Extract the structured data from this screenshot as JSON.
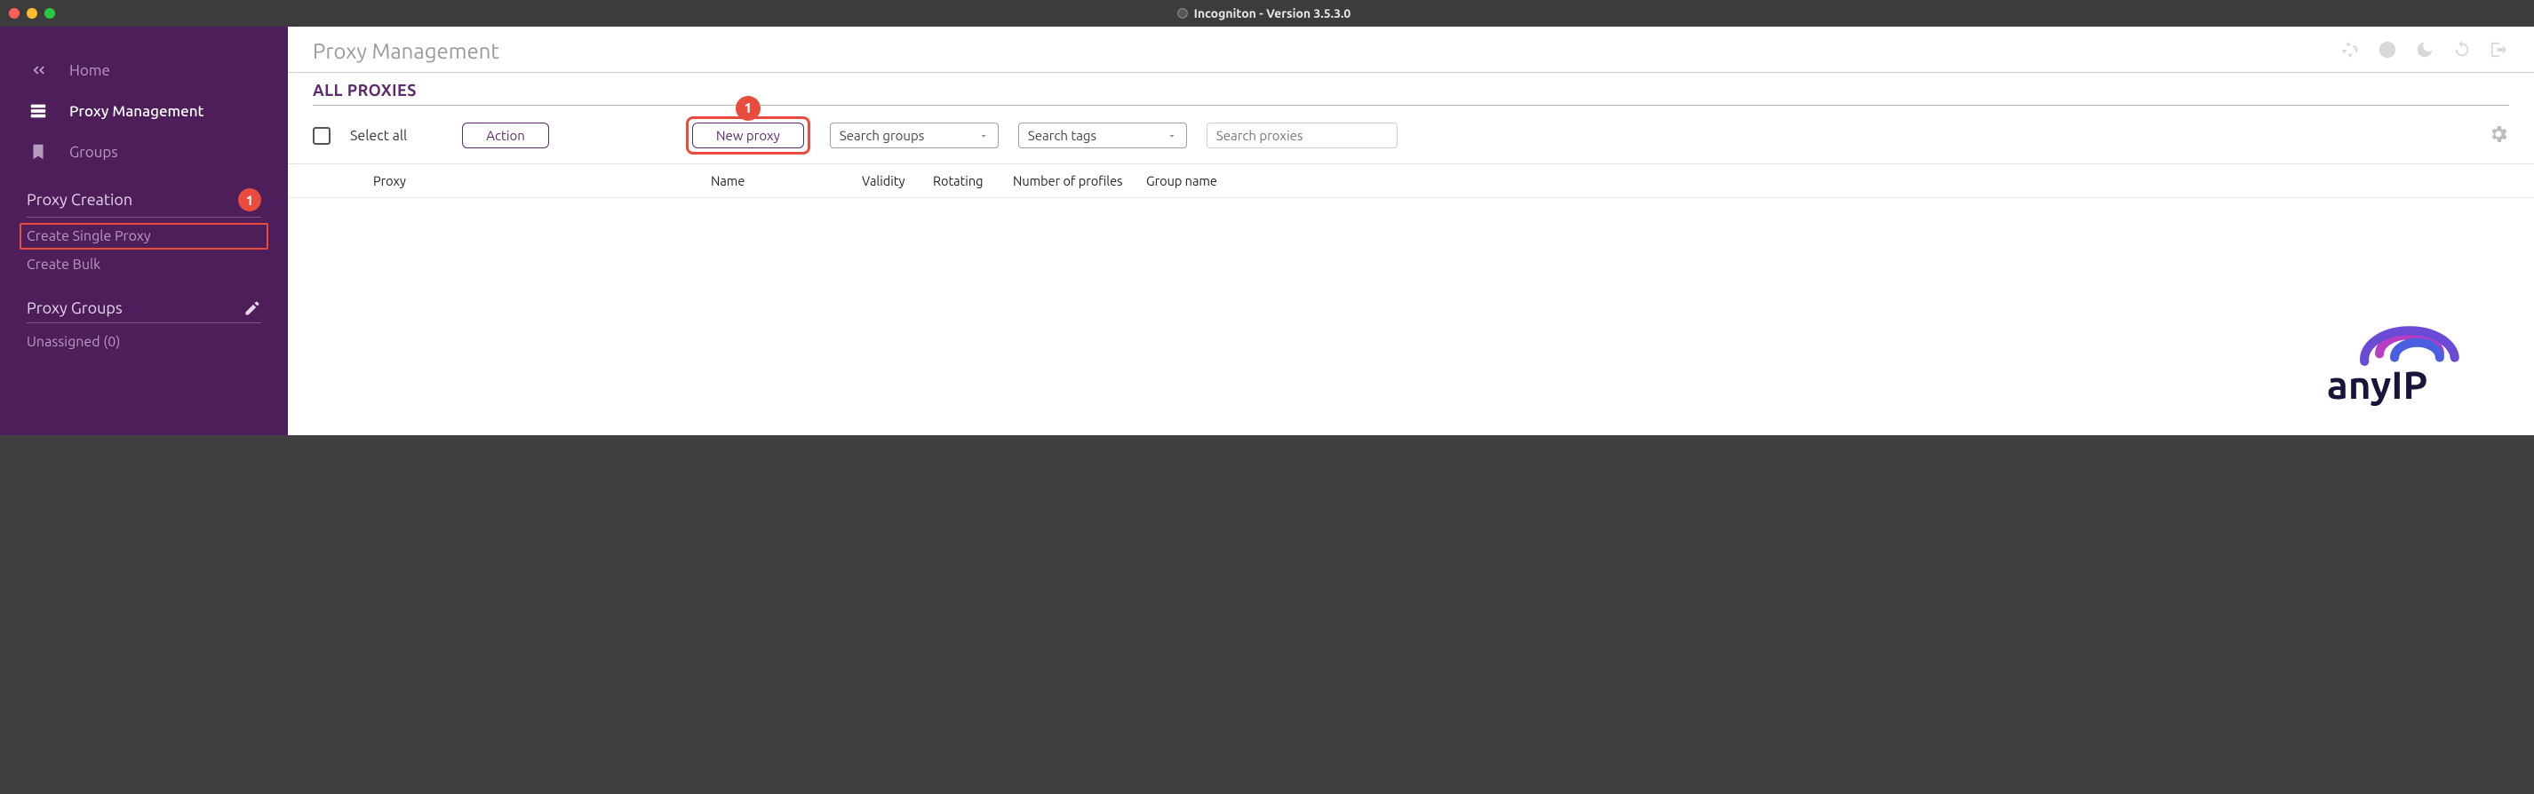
{
  "window": {
    "title": "Incogniton - Version 3.5.3.0"
  },
  "traffic_lights": {
    "close": "#ff5f57",
    "min": "#ffbd2e",
    "max": "#28c940"
  },
  "sidebar": {
    "nav": {
      "home": "Home",
      "proxy_mgmt": "Proxy Management",
      "groups": "Groups"
    },
    "section_creation": {
      "title": "Proxy Creation",
      "badge": "1",
      "create_single": "Create Single Proxy",
      "create_bulk": "Create Bulk"
    },
    "section_groups": {
      "title": "Proxy Groups",
      "unassigned": "Unassigned (0)"
    }
  },
  "main": {
    "page_title": "Proxy Management",
    "subheader": "ALL PROXIES",
    "toolbar": {
      "select_all": "Select all",
      "action": "Action",
      "new_proxy": "New proxy",
      "new_proxy_badge": "1",
      "dd_groups": "Search groups",
      "dd_tags": "Search tags",
      "search_placeholder": "Search proxies"
    },
    "columns": {
      "proxy": "Proxy",
      "name": "Name",
      "validity": "Validity",
      "rotating": "Rotating",
      "num_profiles": "Number of profiles",
      "group_name": "Group name"
    }
  },
  "watermark": {
    "text": "anyIP"
  }
}
